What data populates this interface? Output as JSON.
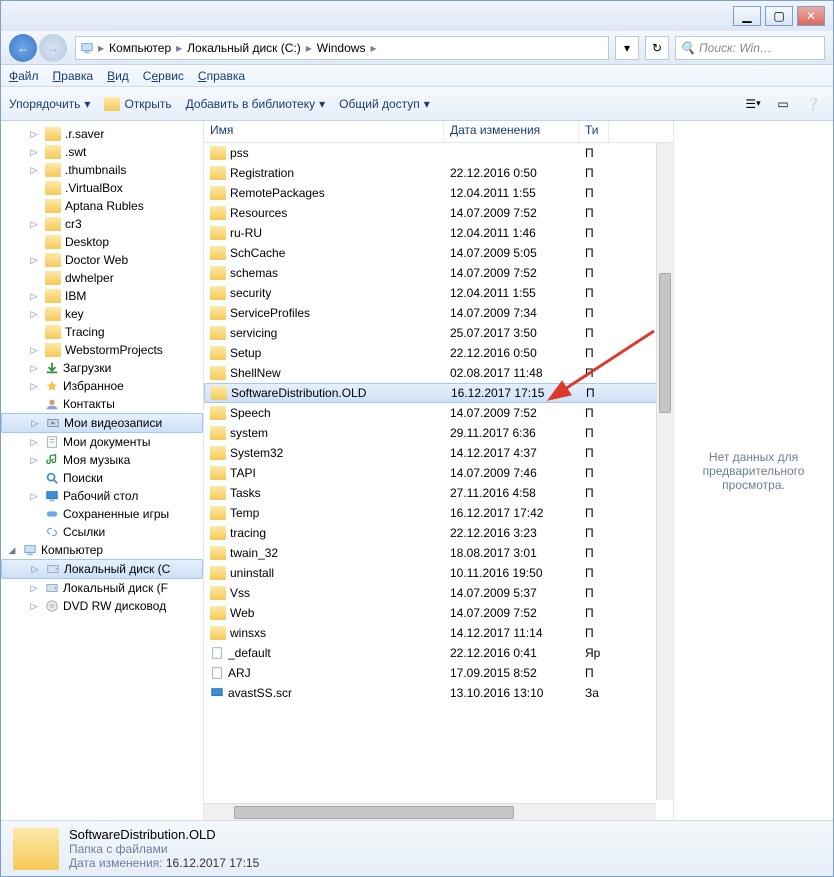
{
  "titlebar": {
    "min": "▁",
    "max": "▢",
    "close": "✕"
  },
  "nav": {
    "breadcrumb": [
      "Компьютер",
      "Локальный диск (C:)",
      "Windows"
    ],
    "search_placeholder": "Поиск: Win…"
  },
  "menubar": [
    "Файл",
    "Правка",
    "Вид",
    "Сервис",
    "Справка"
  ],
  "toolbar": {
    "organize": "Упорядочить",
    "open": "Открыть",
    "add_to_library": "Добавить в библиотеку",
    "share": "Общий доступ"
  },
  "tree": [
    {
      "label": ".r.saver",
      "lvl": 1,
      "exp": "▷"
    },
    {
      "label": ".swt",
      "lvl": 1,
      "exp": "▷"
    },
    {
      "label": ".thumbnails",
      "lvl": 1,
      "exp": "▷"
    },
    {
      "label": ".VirtualBox",
      "lvl": 1,
      "exp": ""
    },
    {
      "label": "Aptana Rubles",
      "lvl": 1,
      "exp": ""
    },
    {
      "label": "cr3",
      "lvl": 1,
      "exp": "▷"
    },
    {
      "label": "Desktop",
      "lvl": 1,
      "exp": ""
    },
    {
      "label": "Doctor Web",
      "lvl": 1,
      "exp": "▷"
    },
    {
      "label": "dwhelper",
      "lvl": 1,
      "exp": ""
    },
    {
      "label": "IBM",
      "lvl": 1,
      "exp": "▷"
    },
    {
      "label": "key",
      "lvl": 1,
      "exp": "▷"
    },
    {
      "label": "Tracing",
      "lvl": 1,
      "exp": ""
    },
    {
      "label": "WebstormProjects",
      "lvl": 1,
      "exp": "▷"
    },
    {
      "label": "Загрузки",
      "lvl": 1,
      "exp": "▷",
      "icon": "download"
    },
    {
      "label": "Избранное",
      "lvl": 1,
      "exp": "▷",
      "icon": "favorites"
    },
    {
      "label": "Контакты",
      "lvl": 1,
      "exp": "",
      "icon": "contacts"
    },
    {
      "label": "Мои видеозаписи",
      "lvl": 1,
      "exp": "▷",
      "icon": "video",
      "selected": true
    },
    {
      "label": "Мои документы",
      "lvl": 1,
      "exp": "▷",
      "icon": "docs"
    },
    {
      "label": "Моя музыка",
      "lvl": 1,
      "exp": "▷",
      "icon": "music"
    },
    {
      "label": "Поиски",
      "lvl": 1,
      "exp": "",
      "icon": "search"
    },
    {
      "label": "Рабочий стол",
      "lvl": 1,
      "exp": "▷",
      "icon": "desktop"
    },
    {
      "label": "Сохраненные игры",
      "lvl": 1,
      "exp": "",
      "icon": "games"
    },
    {
      "label": "Ссылки",
      "lvl": 1,
      "exp": "",
      "icon": "links"
    },
    {
      "label": "Компьютер",
      "lvl": 0,
      "exp": "◢",
      "icon": "computer"
    },
    {
      "label": "Локальный диск (C",
      "lvl": 1,
      "exp": "▷",
      "icon": "disk",
      "selected": true
    },
    {
      "label": "Локальный диск (F",
      "lvl": 1,
      "exp": "▷",
      "icon": "disk"
    },
    {
      "label": "DVD RW дисковод",
      "lvl": 1,
      "exp": "▷",
      "icon": "dvd"
    }
  ],
  "columns": {
    "name": "Имя",
    "date": "Дата изменения",
    "type": "Ти"
  },
  "files": [
    {
      "name": "pss",
      "date": "",
      "type": "П",
      "icon": "folder"
    },
    {
      "name": "Registration",
      "date": "22.12.2016 0:50",
      "type": "П",
      "icon": "folder"
    },
    {
      "name": "RemotePackages",
      "date": "12.04.2011 1:55",
      "type": "П",
      "icon": "folder"
    },
    {
      "name": "Resources",
      "date": "14.07.2009 7:52",
      "type": "П",
      "icon": "folder"
    },
    {
      "name": "ru-RU",
      "date": "12.04.2011 1:46",
      "type": "П",
      "icon": "folder"
    },
    {
      "name": "SchCache",
      "date": "14.07.2009 5:05",
      "type": "П",
      "icon": "folder"
    },
    {
      "name": "schemas",
      "date": "14.07.2009 7:52",
      "type": "П",
      "icon": "folder"
    },
    {
      "name": "security",
      "date": "12.04.2011 1:55",
      "type": "П",
      "icon": "folder"
    },
    {
      "name": "ServiceProfiles",
      "date": "14.07.2009 7:34",
      "type": "П",
      "icon": "folder"
    },
    {
      "name": "servicing",
      "date": "25.07.2017 3:50",
      "type": "П",
      "icon": "folder"
    },
    {
      "name": "Setup",
      "date": "22.12.2016 0:50",
      "type": "П",
      "icon": "folder"
    },
    {
      "name": "ShellNew",
      "date": "02.08.2017 11:48",
      "type": "П",
      "icon": "folder"
    },
    {
      "name": "SoftwareDistribution.OLD",
      "date": "16.12.2017 17:15",
      "type": "П",
      "icon": "folder",
      "selected": true
    },
    {
      "name": "Speech",
      "date": "14.07.2009 7:52",
      "type": "П",
      "icon": "folder"
    },
    {
      "name": "system",
      "date": "29.11.2017 6:36",
      "type": "П",
      "icon": "folder"
    },
    {
      "name": "System32",
      "date": "14.12.2017 4:37",
      "type": "П",
      "icon": "folder"
    },
    {
      "name": "TAPI",
      "date": "14.07.2009 7:46",
      "type": "П",
      "icon": "folder"
    },
    {
      "name": "Tasks",
      "date": "27.11.2016 4:58",
      "type": "П",
      "icon": "folder"
    },
    {
      "name": "Temp",
      "date": "16.12.2017 17:42",
      "type": "П",
      "icon": "folder"
    },
    {
      "name": "tracing",
      "date": "22.12.2016 3:23",
      "type": "П",
      "icon": "folder"
    },
    {
      "name": "twain_32",
      "date": "18.08.2017 3:01",
      "type": "П",
      "icon": "folder"
    },
    {
      "name": "uninstall",
      "date": "10.11.2016 19:50",
      "type": "П",
      "icon": "folder"
    },
    {
      "name": "Vss",
      "date": "14.07.2009 5:37",
      "type": "П",
      "icon": "folder"
    },
    {
      "name": "Web",
      "date": "14.07.2009 7:52",
      "type": "П",
      "icon": "folder"
    },
    {
      "name": "winsxs",
      "date": "14.12.2017 11:14",
      "type": "П",
      "icon": "folder"
    },
    {
      "name": "_default",
      "date": "22.12.2016 0:41",
      "type": "Яр",
      "icon": "file"
    },
    {
      "name": "ARJ",
      "date": "17.09.2015 8:52",
      "type": "П",
      "icon": "file"
    },
    {
      "name": "avastSS.scr",
      "date": "13.10.2016 13:10",
      "type": "За",
      "icon": "scr"
    }
  ],
  "preview": {
    "msg_line1": "Нет данных для",
    "msg_line2": "предварительного",
    "msg_line3": "просмотра."
  },
  "details": {
    "name": "SoftwareDistribution.OLD",
    "type": "Папка с файлами",
    "mod_label": "Дата изменения:",
    "mod_value": "16.12.2017 17:15"
  }
}
